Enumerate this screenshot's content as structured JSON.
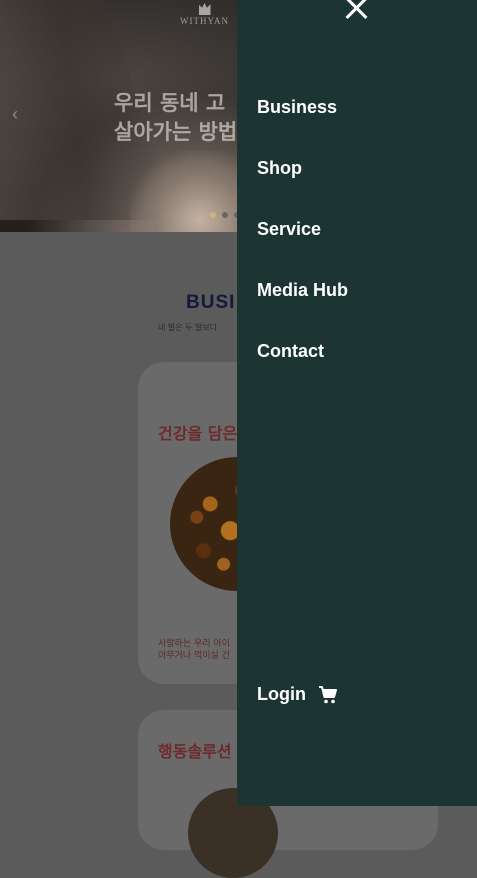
{
  "hero": {
    "logo_text": "WITHYAN",
    "title": "우리 동네 고\n살아가는 방법",
    "prev_icon": "chevron-left-icon",
    "slides": 3,
    "active_slide": 1
  },
  "business": {
    "title": "BUSI",
    "subtitle": "네 발은 두 발보다"
  },
  "cards": [
    {
      "title": "건강을 담은",
      "desc": "사랑하는 우리 아이\n아무거나 먹이실 건"
    },
    {
      "title": "행동솔루션"
    }
  ],
  "drawer": {
    "close_icon": "close-icon",
    "nav": [
      {
        "label": "Business"
      },
      {
        "label": "Shop"
      },
      {
        "label": "Service"
      },
      {
        "label": "Media Hub"
      },
      {
        "label": "Contact"
      }
    ],
    "login_label": "Login",
    "cart_icon": "cart-icon"
  },
  "colors": {
    "drawer_bg": "#1c3532",
    "overlay": "#5b5b5b",
    "text_on_drawer": "#ffffff",
    "section_title": "#14183a",
    "card_title": "#6e2a2a"
  }
}
